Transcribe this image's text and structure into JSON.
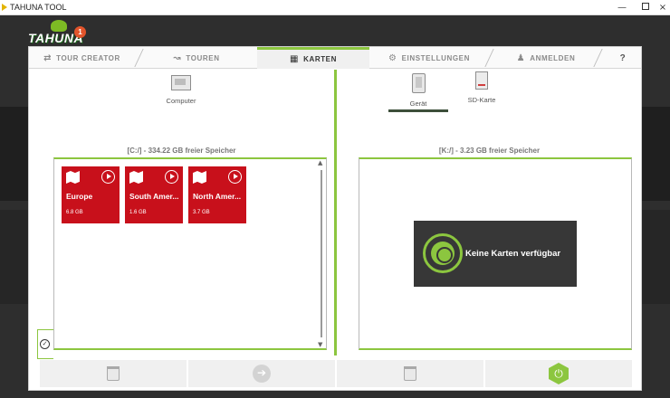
{
  "window": {
    "title": "TAHUNA TOOL",
    "minimize": "—",
    "close": "×"
  },
  "logo": {
    "wordmark": "TAHUNA",
    "badge": "1"
  },
  "tabs": [
    {
      "label": "TOUR CREATOR",
      "icon": "share-icon",
      "glyph": "⇄"
    },
    {
      "label": "TOUREN",
      "icon": "route-icon",
      "glyph": "↝"
    },
    {
      "label": "KARTEN",
      "icon": "map-icon",
      "glyph": "▦"
    },
    {
      "label": "EINSTELLUNGEN",
      "icon": "gear-icon",
      "glyph": "⚙"
    },
    {
      "label": "ANMELDEN",
      "icon": "user-icon",
      "glyph": "♟"
    },
    {
      "label": "?",
      "icon": "help-icon",
      "glyph": ""
    }
  ],
  "active_tab": "KARTEN",
  "left": {
    "source_label": "Computer",
    "storage": "[C:/] - 334.22 GB freier Speicher",
    "maps": [
      {
        "name": "Europe",
        "size": "6.8 GB"
      },
      {
        "name": "South Amer...",
        "size": "1.6 GB"
      },
      {
        "name": "North Amer...",
        "size": "3.7 GB"
      }
    ],
    "scroll_up": "▲",
    "scroll_down": "▼",
    "toggle_glyph": "✓"
  },
  "right": {
    "sources": [
      {
        "label": "Gerät",
        "selected": true
      },
      {
        "label": "SD-Karte",
        "selected": false
      }
    ],
    "storage": "[K:/] - 3.23 GB freier Speicher",
    "empty_message": "Keine Karten verfügbar"
  },
  "actions": {
    "arrow_glyph": "➔"
  },
  "colors": {
    "accent": "#8cc63f",
    "tile": "#c8101b",
    "empty_bg": "#373737"
  }
}
